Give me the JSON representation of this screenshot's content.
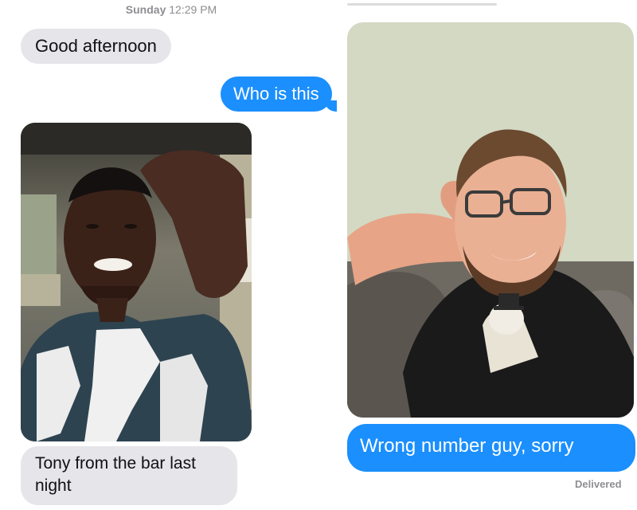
{
  "left_thread": {
    "timestamp_day": "Sunday",
    "timestamp_time": "12:29 PM",
    "messages": [
      {
        "direction": "incoming",
        "text": "Good afternoon"
      },
      {
        "direction": "outgoing",
        "text": "Who is this"
      },
      {
        "direction": "incoming",
        "type": "photo",
        "icon": "selfie-photo-man-in-car"
      },
      {
        "direction": "incoming",
        "text": "Tony from the bar last night"
      }
    ]
  },
  "right_thread": {
    "messages": [
      {
        "direction": "outgoing",
        "type": "photo",
        "icon": "selfie-photo-man-with-glasses"
      },
      {
        "direction": "outgoing",
        "text": "Wrong number guy, sorry"
      }
    ],
    "status": "Delivered"
  },
  "colors": {
    "incoming_bubble": "#e5e5ea",
    "outgoing_bubble": "#1b8ffd",
    "timestamp": "#8e8e93"
  }
}
